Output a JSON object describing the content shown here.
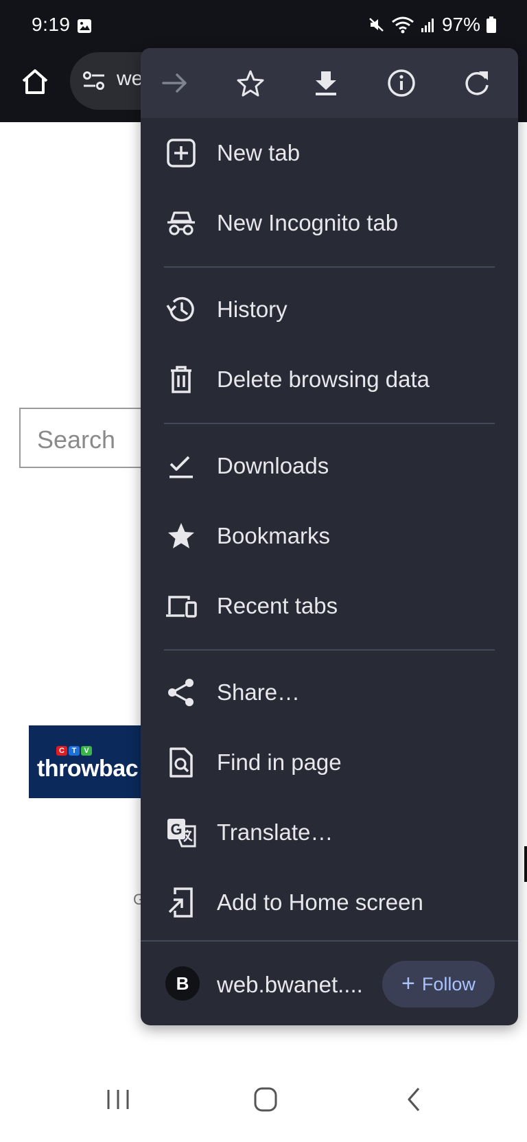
{
  "status_bar": {
    "time": "9:19",
    "battery": "97%"
  },
  "address_bar": {
    "url_partial": "we"
  },
  "page": {
    "search_placeholder": "Search",
    "stray_text": "G"
  },
  "menu": {
    "toolbar": [
      "forward-icon",
      "bookmark-star-icon",
      "download-icon",
      "info-icon",
      "refresh-icon"
    ],
    "items": [
      {
        "label": "New tab",
        "icon": "new-tab-icon"
      },
      {
        "label": "New Incognito tab",
        "icon": "incognito-icon"
      },
      {
        "label": "History",
        "icon": "history-icon"
      },
      {
        "label": "Delete browsing data",
        "icon": "trash-icon"
      },
      {
        "label": "Downloads",
        "icon": "downloads-check-icon"
      },
      {
        "label": "Bookmarks",
        "icon": "bookmarks-star-icon"
      },
      {
        "label": "Recent tabs",
        "icon": "devices-icon"
      },
      {
        "label": "Share…",
        "icon": "share-icon"
      },
      {
        "label": "Find in page",
        "icon": "find-in-page-icon"
      },
      {
        "label": "Translate…",
        "icon": "translate-icon"
      },
      {
        "label": "Add to Home screen",
        "icon": "add-to-home-icon"
      }
    ],
    "footer": {
      "avatar_letter": "B",
      "site": "web.bwanet....",
      "follow_label": "Follow"
    }
  },
  "colors": {
    "menu_bg": "#282a36",
    "menu_toolbar": "#323441",
    "follow_text": "#a9c3ff",
    "banner_bg": "#0b2a5b"
  }
}
